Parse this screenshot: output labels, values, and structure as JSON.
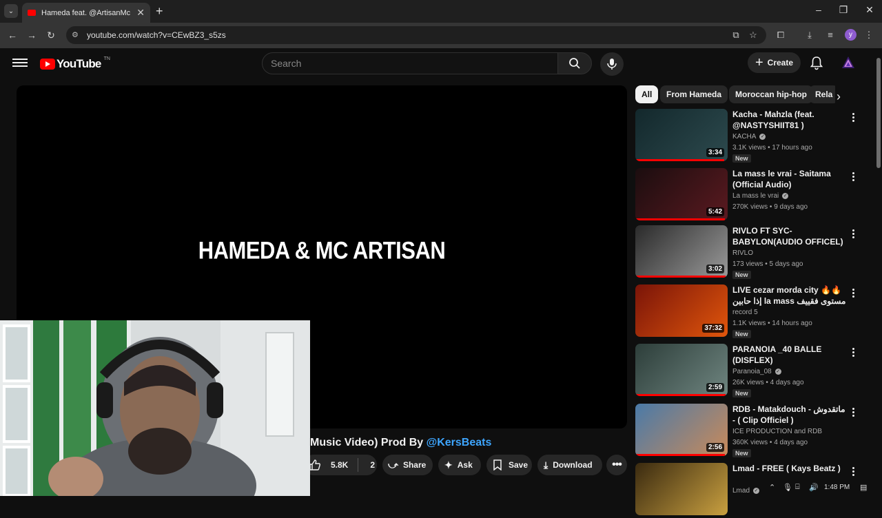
{
  "browser": {
    "tab_title": "Hameda feat. @ArtisanMc - We",
    "new_tab": "+",
    "url": "youtube.com/watch?v=CEwBZ3_s5zs",
    "profile_initial": "Y"
  },
  "yt": {
    "logo_text": "YouTube",
    "country_code": "TN",
    "search_placeholder": "Search",
    "create_label": "Create"
  },
  "player": {
    "overlay_text": "HAMEDA & MC ARTISAN"
  },
  "video": {
    "title_visible": "Music Video) Prod By ",
    "title_mention": "@KersBeats",
    "likes": "5.8K",
    "comments_count": "2",
    "share_label": "Share",
    "ask_label": "Ask",
    "save_label": "Save",
    "download_label": "Download"
  },
  "chips": [
    {
      "label": "All",
      "active": true
    },
    {
      "label": "From Hameda",
      "active": false
    },
    {
      "label": "Moroccan hip-hop",
      "active": false
    },
    {
      "label": "Rela",
      "active": false
    }
  ],
  "recommendations": [
    {
      "title": "Kacha - Mahzla (feat. @NASTYSHIIT81  )",
      "channel": "KACHA",
      "verified": true,
      "meta": "3.1K views • 17 hours ago",
      "badge": "New",
      "duration": "3:34",
      "progress": 0.96,
      "colors": [
        "#13282c",
        "#2d4a4e"
      ]
    },
    {
      "title": "La mass le vrai - Saitama (Official Audio)",
      "channel": "La mass le vrai",
      "verified": true,
      "meta": "270K views • 9 days ago",
      "badge": "",
      "duration": "5:42",
      "progress": 0.97,
      "colors": [
        "#1b0d0f",
        "#5b1a20"
      ]
    },
    {
      "title": "RIVLO FT SYC-BABYLON(AUDIO OFFICEL)",
      "channel": "RIVLO",
      "verified": false,
      "meta": "173 views • 5 days ago",
      "badge": "New",
      "duration": "3:02",
      "progress": 0.98,
      "colors": [
        "#2a2a2a",
        "#9a9a9a"
      ]
    },
    {
      "title": "LIVE cezar morda city 🔥🔥 إذا حابين la mass مستوى فقييف اخرجو من...",
      "channel": "record 5",
      "verified": false,
      "meta": "1.1K views • 14 hours ago",
      "badge": "New",
      "duration": "37:32",
      "progress": 0.0,
      "colors": [
        "#7a1408",
        "#e0560c"
      ]
    },
    {
      "title": "PARANOIA _40 BALLE (DISFLEX)",
      "channel": "Paranoia_08",
      "verified": true,
      "meta": "26K views • 4 days ago",
      "badge": "New",
      "duration": "2:59",
      "progress": 0.98,
      "colors": [
        "#2d3e3a",
        "#6f8580"
      ]
    },
    {
      "title": "RDB - Matakdouch - ماتقدوش - ( Clip Officiel )",
      "channel": "ICE PRODUCTION and RDB",
      "verified": false,
      "meta": "360K views • 4 days ago",
      "badge": "New",
      "duration": "2:56",
      "progress": 0.97,
      "colors": [
        "#4a7aa8",
        "#c98a5a"
      ]
    },
    {
      "title": "Lmad - FREE  ( Kays Beatz )",
      "channel": "Lmad",
      "verified": true,
      "meta": "",
      "badge": "",
      "duration": "",
      "progress": 0.0,
      "colors": [
        "#3a2a10",
        "#c9a040"
      ]
    }
  ],
  "tray": {
    "time": "1:48 PM"
  }
}
